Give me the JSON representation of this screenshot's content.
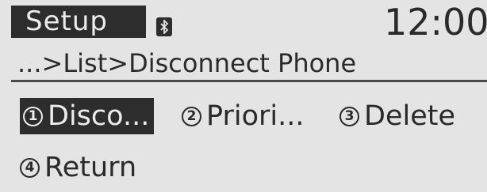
{
  "header": {
    "title": "Setup",
    "bluetooth_icon": "bluetooth-icon",
    "clock": "12:00"
  },
  "breadcrumb": "...>List>Disconnect Phone",
  "menu": {
    "items": [
      {
        "number": "1",
        "label": "Disco...",
        "selected": true
      },
      {
        "number": "2",
        "label": "Priori...",
        "selected": false
      },
      {
        "number": "3",
        "label": "Delete",
        "selected": false
      },
      {
        "number": "4",
        "label": "Return",
        "selected": false
      }
    ]
  },
  "colors": {
    "background": "#e4e4e4",
    "highlight": "#2d2d2d",
    "text": "#2a2a2a"
  }
}
